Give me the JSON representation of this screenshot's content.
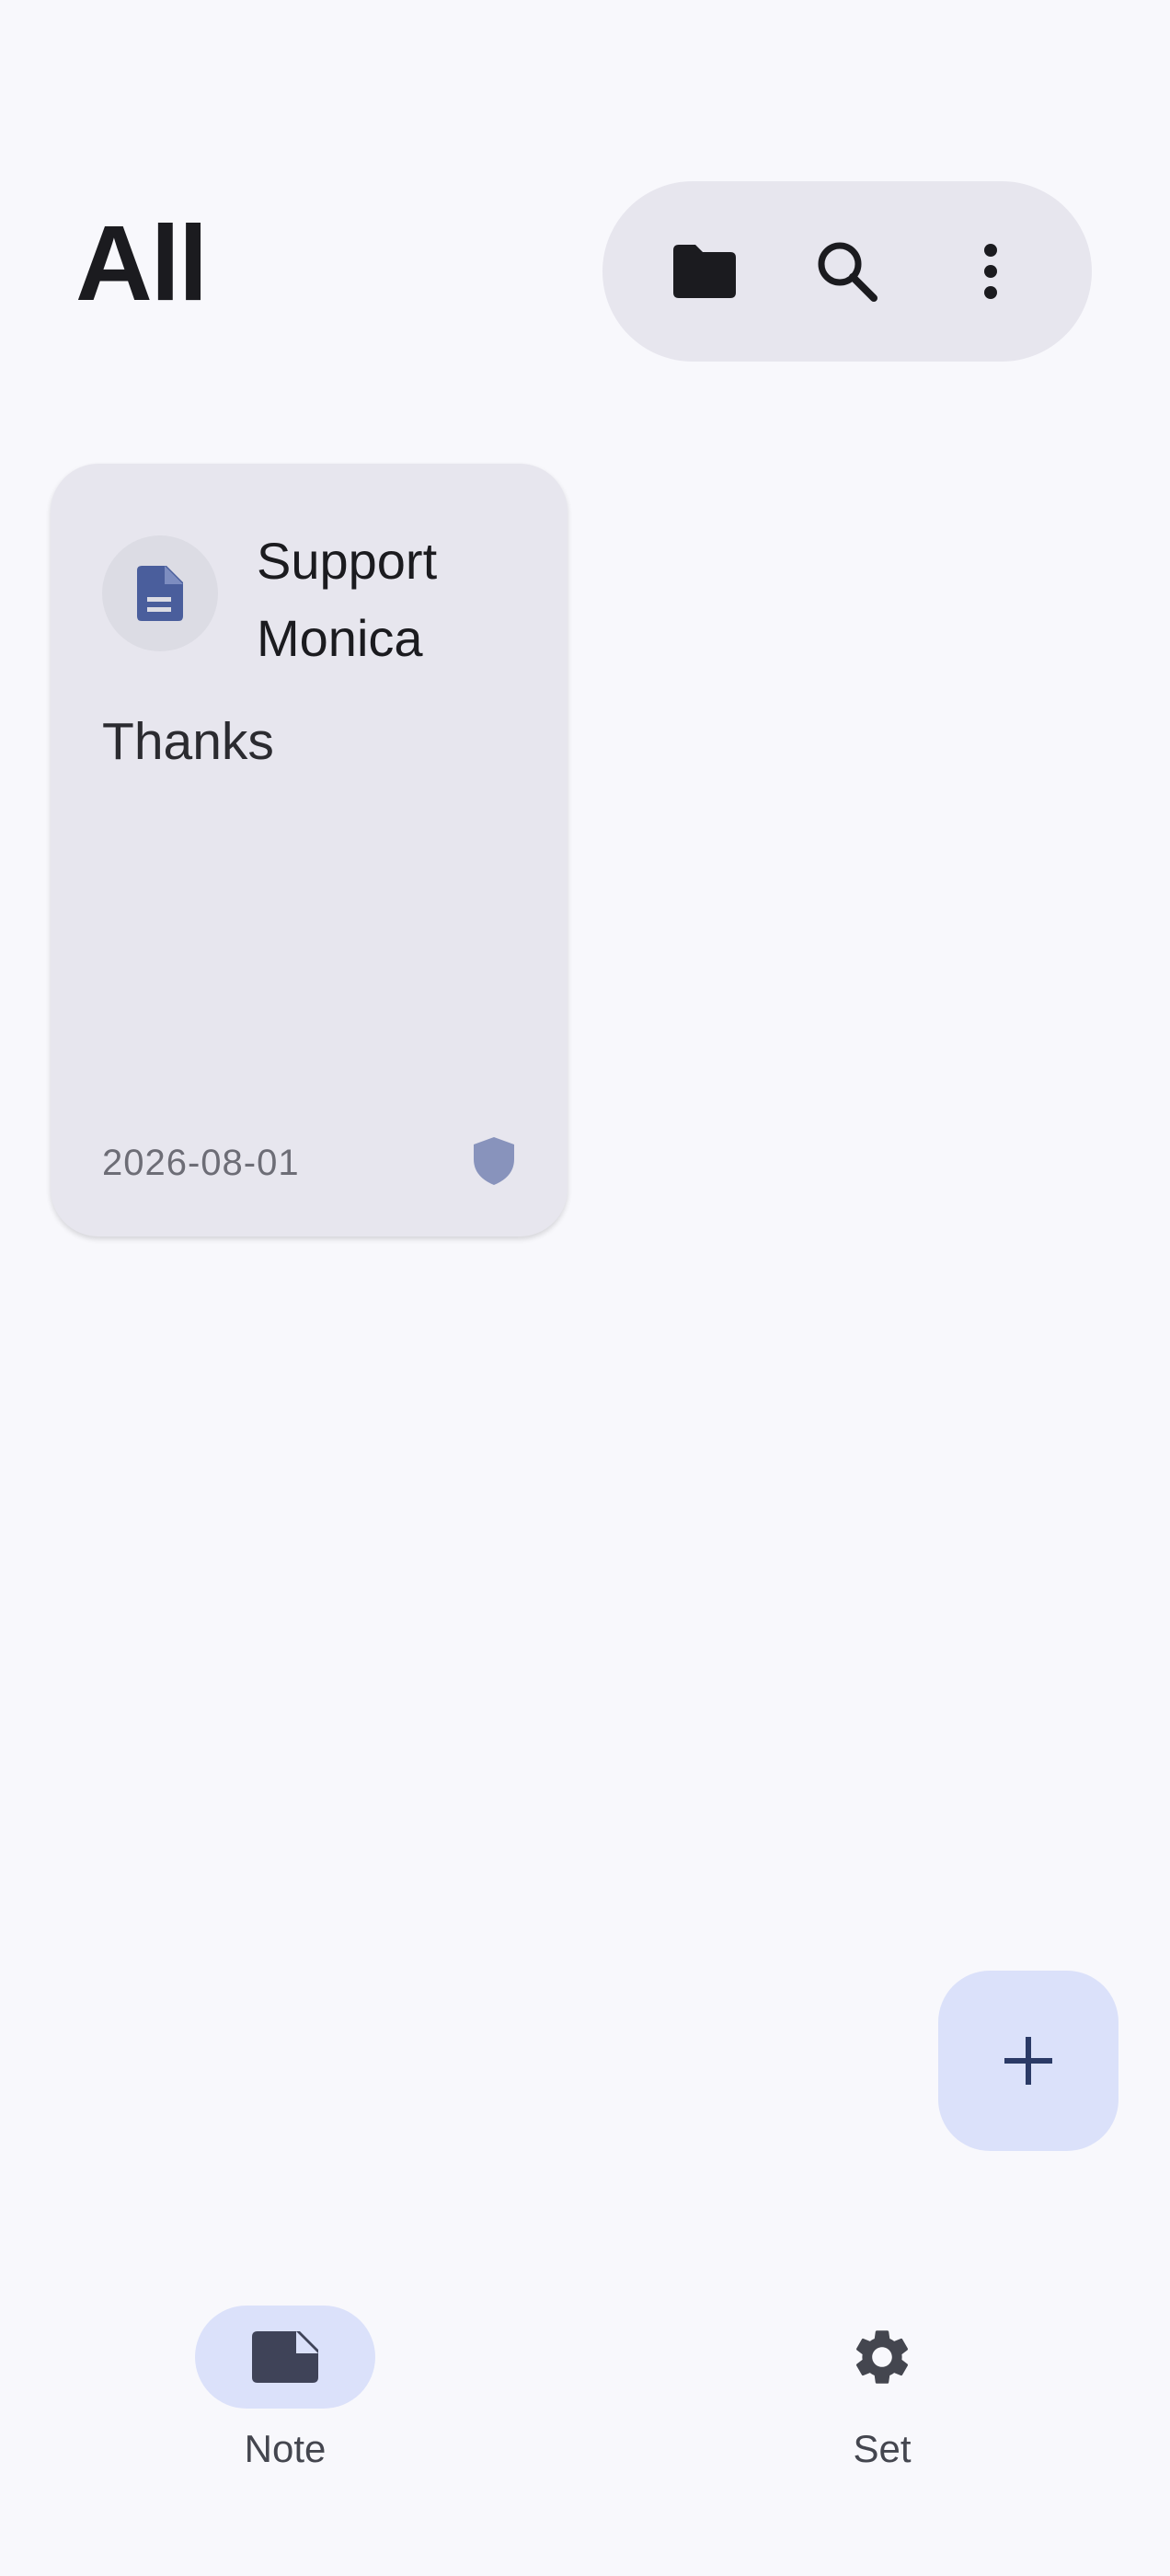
{
  "header": {
    "title": "All"
  },
  "toolbar": {
    "folder_icon": "folder-icon",
    "search_icon": "search-icon",
    "more_icon": "more-vert-icon"
  },
  "notes": [
    {
      "title": "Support Monica",
      "body": "Thanks",
      "date": "2026-08-01",
      "type_icon": "document-icon",
      "status_icon": "shield-icon"
    }
  ],
  "fab": {
    "icon": "plus-icon"
  },
  "bottom_nav": {
    "items": [
      {
        "label": "Note",
        "icon": "note-icon",
        "active": true
      },
      {
        "label": "Set",
        "icon": "gear-icon",
        "active": false
      }
    ]
  },
  "colors": {
    "background": "#f8f8fc",
    "surface": "#e7e6ee",
    "accent_container": "#dbe1fa",
    "accent": "#4a5e9c",
    "on_accent_container": "#2b3a66"
  }
}
